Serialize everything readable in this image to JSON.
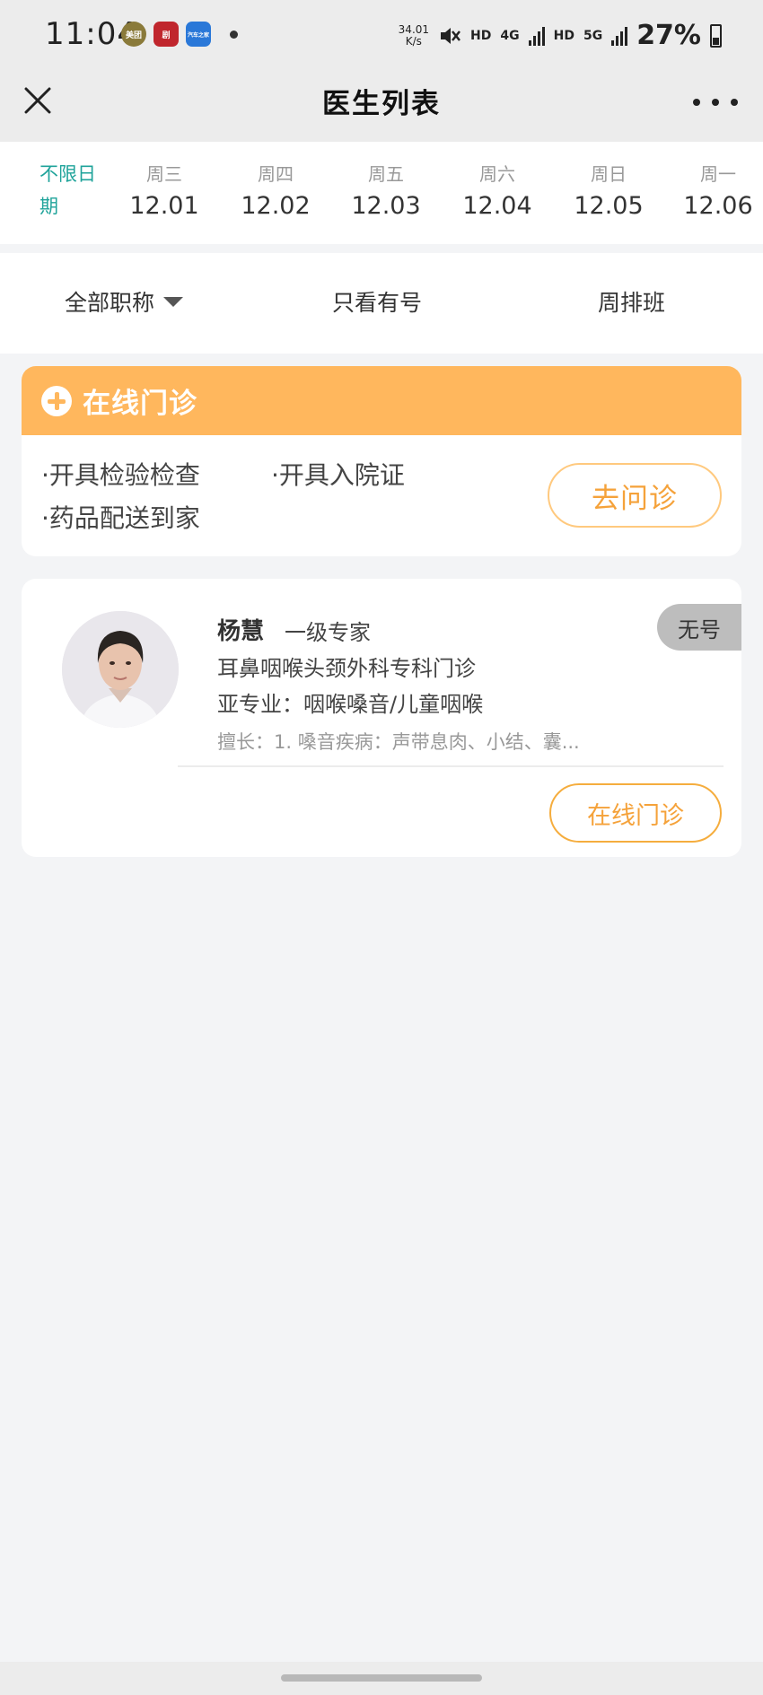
{
  "status_bar": {
    "time": "11:04",
    "app_icons": [
      "美团",
      "剧",
      "汽车之家"
    ],
    "net_speed_value": "34.01",
    "net_speed_unit": "K/s",
    "hd1": "HD",
    "network_4g": "4G",
    "hd2": "HD",
    "network_5g": "5G",
    "battery": "27%"
  },
  "nav": {
    "title": "医生列表"
  },
  "date_strip": {
    "any_label": "不限日期",
    "days": [
      {
        "weekday": "周三",
        "date": "12.01"
      },
      {
        "weekday": "周四",
        "date": "12.02"
      },
      {
        "weekday": "周五",
        "date": "12.03"
      },
      {
        "weekday": "周六",
        "date": "12.04"
      },
      {
        "weekday": "周日",
        "date": "12.05"
      },
      {
        "weekday": "周一",
        "date": "12.06"
      }
    ]
  },
  "filters": {
    "title_filter": "全部职称",
    "available_only": "只看有号",
    "weekly_schedule": "周排班"
  },
  "clinic_card": {
    "title": "在线门诊",
    "features": [
      "·开具检验检查",
      "·开具入院证",
      "·药品配送到家"
    ],
    "button": "去问诊"
  },
  "doctor": {
    "name": "杨慧",
    "title": "一级专家",
    "department": "耳鼻咽喉头颈外科专科门诊",
    "subspecialty": "亚专业：咽喉嗓音/儿童咽喉",
    "skill": "擅长：1. 嗓音疾病：声带息肉、小结、囊...",
    "status_badge": "无号",
    "button": "在线门诊"
  },
  "colors": {
    "accent_teal": "#1fa39a",
    "orange_header": "#ffb75d",
    "orange_text": "#f5a23a"
  }
}
